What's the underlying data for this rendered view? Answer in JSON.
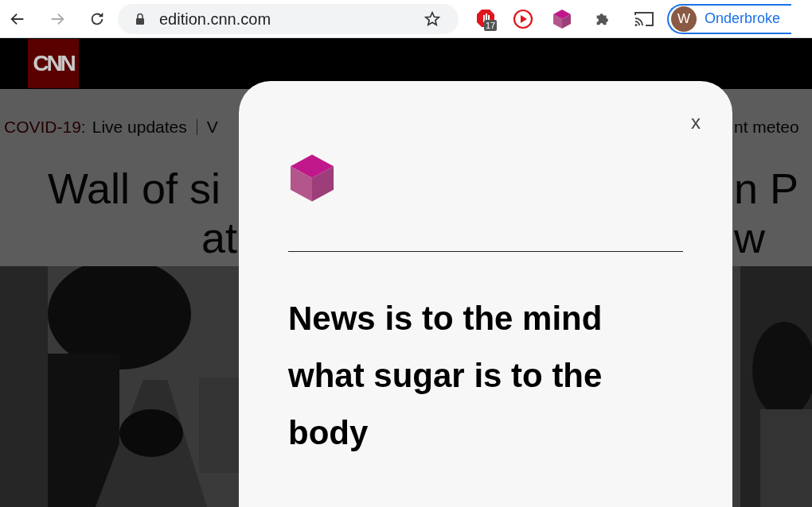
{
  "browser": {
    "back": {
      "disabled": false
    },
    "forward": {
      "disabled": true
    },
    "url": "edition.cnn.com",
    "extension_badge": "17",
    "profile": {
      "initial": "W",
      "label": "Onderbroke"
    }
  },
  "page": {
    "logo": "CNN",
    "breaking_label": "COVID-19:",
    "breaking_link": "Live updates",
    "left_fragment": "V",
    "right_fragment": "nt meteo",
    "headline_left": [
      "Wall of si",
      "at"
    ],
    "headline_right": [
      "n P",
      "w"
    ]
  },
  "modal": {
    "close": "x",
    "quote": "News is to the mind what sugar is to the body"
  }
}
